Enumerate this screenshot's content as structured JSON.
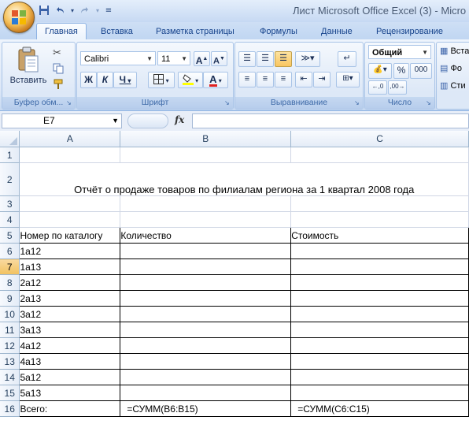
{
  "window": {
    "title": "Лист Microsoft Office Excel (3) - Micro",
    "colors": {
      "title_bg": "#c6d9f3",
      "accent": "#15428b",
      "selected_header": "#f1c15f"
    }
  },
  "qat": {
    "save_icon": "save-icon",
    "undo_icon": "undo-icon",
    "redo_icon": "redo-icon",
    "customize_icon": "customize-qat-icon"
  },
  "tabs": [
    {
      "label": "Главная",
      "active": true
    },
    {
      "label": "Вставка"
    },
    {
      "label": "Разметка страницы"
    },
    {
      "label": "Формулы"
    },
    {
      "label": "Данные"
    },
    {
      "label": "Рецензирование"
    }
  ],
  "ribbon": {
    "clipboard": {
      "label": "Буфер обм...",
      "paste_label": "Вставить"
    },
    "font": {
      "label": "Шрифт",
      "font_name": "Calibri",
      "font_size": "11",
      "bold": "Ж",
      "italic": "К",
      "underline": "Ч",
      "grow": "A",
      "shrink": "A"
    },
    "alignment": {
      "label": "Выравнивание"
    },
    "number": {
      "label": "Число",
      "format": "Общий",
      "percent": "%",
      "thousands": "000"
    },
    "cells": {
      "insert_label": "Вста",
      "format_label": "Фо",
      "style_label": "Сти"
    }
  },
  "formula_bar": {
    "name_box": "E7",
    "fx_label": "fx",
    "formula": ""
  },
  "sheet": {
    "columns": [
      "A",
      "B",
      "C"
    ],
    "selected_row": "7",
    "title": "Отчёт о продаже товаров по филиалам региона за 1 квартал 2008 года",
    "rows": [
      {
        "n": "1",
        "a": "",
        "b": "",
        "c": ""
      },
      {
        "n": "2",
        "a": "",
        "b": "",
        "c": ""
      },
      {
        "n": "3",
        "a": "",
        "b": "",
        "c": ""
      },
      {
        "n": "4",
        "a": "",
        "b": "",
        "c": ""
      },
      {
        "n": "5",
        "a": "Номер по каталогу",
        "b": "Количество",
        "c": "Стоимость"
      },
      {
        "n": "6",
        "a": "1а12",
        "b": "",
        "c": ""
      },
      {
        "n": "7",
        "a": "1а13",
        "b": "",
        "c": ""
      },
      {
        "n": "8",
        "a": "2а12",
        "b": "",
        "c": ""
      },
      {
        "n": "9",
        "a": "2а13",
        "b": "",
        "c": ""
      },
      {
        "n": "10",
        "a": "3а12",
        "b": "",
        "c": ""
      },
      {
        "n": "11",
        "a": "3а13",
        "b": "",
        "c": ""
      },
      {
        "n": "12",
        "a": "4а12",
        "b": "",
        "c": ""
      },
      {
        "n": "13",
        "a": "4а13",
        "b": "",
        "c": ""
      },
      {
        "n": "14",
        "a": "5а12",
        "b": "",
        "c": ""
      },
      {
        "n": "15",
        "a": "5а13",
        "b": "",
        "c": ""
      },
      {
        "n": "16",
        "a": "Всего:",
        "b": "=СУММ(B6:B15)",
        "c": "=СУММ(C6:C15)"
      }
    ]
  }
}
